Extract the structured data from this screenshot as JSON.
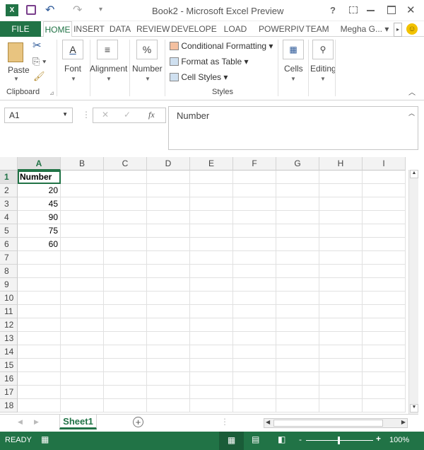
{
  "window": {
    "title": "Book2 - Microsoft Excel Preview",
    "help": "?",
    "user": "Megha G..."
  },
  "tabs": [
    {
      "label": "FILE"
    },
    {
      "label": "HOME"
    },
    {
      "label": "INSERT"
    },
    {
      "label": "DATA"
    },
    {
      "label": "REVIEW"
    },
    {
      "label": "DEVELOPE"
    },
    {
      "label": "LOAD TES"
    },
    {
      "label": "POWERPIV"
    },
    {
      "label": "TEAM"
    }
  ],
  "ribbon": {
    "paste": "Paste",
    "clipboard": "Clipboard",
    "font": "Font",
    "alignment": "Alignment",
    "number": "Number",
    "number_icon": "%",
    "conditional": "Conditional Formatting",
    "format_table": "Format as Table",
    "cell_styles": "Cell Styles",
    "styles": "Styles",
    "cells": "Cells",
    "editing": "Editing"
  },
  "formula": {
    "name_box": "A1",
    "fx": "fx",
    "content": "Number"
  },
  "columns": [
    "A",
    "B",
    "C",
    "D",
    "E",
    "F",
    "G",
    "H",
    "I"
  ],
  "rows": [
    "1",
    "2",
    "3",
    "4",
    "5",
    "6",
    "7",
    "8",
    "9",
    "10",
    "11",
    "12",
    "13",
    "14",
    "15",
    "16",
    "17",
    "18"
  ],
  "cells": {
    "A1": "Number",
    "A2": "20",
    "A3": "45",
    "A4": "90",
    "A5": "75",
    "A6": "60"
  },
  "sheet_tab": "Sheet1",
  "status": {
    "ready": "READY",
    "zoom": "100%"
  },
  "colors": {
    "brand": "#217346"
  }
}
